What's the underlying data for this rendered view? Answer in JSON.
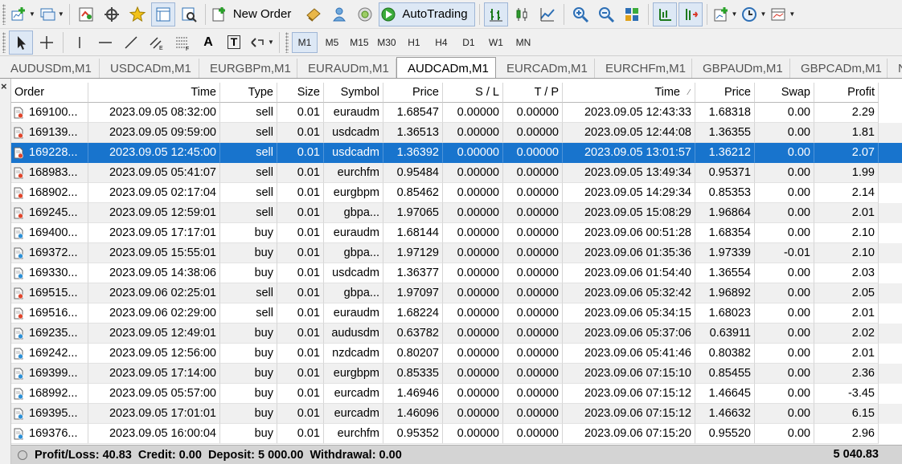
{
  "toolbar_main": {
    "new_order_label": "New Order",
    "autotrading_label": "AutoTrading"
  },
  "toolbar_draw": {
    "timeframes": [
      "M1",
      "M5",
      "M15",
      "M30",
      "H1",
      "H4",
      "D1",
      "W1",
      "MN"
    ],
    "active_timeframe": "M1",
    "text_tool_glyph": "A",
    "text_label_glyph": "T"
  },
  "tabs": [
    "AUDUSDm,M1",
    "USDCADm,M1",
    "EURGBPm,M1",
    "EURAUDm,M1",
    "AUDCADm,M1",
    "EURCADm,M1",
    "EURCHFm,M1",
    "GBPAUDm,M1",
    "GBPCADm,M1",
    "N"
  ],
  "active_tab": "AUDCADm,M1",
  "close_glyph": "×",
  "columns": [
    "Order",
    "Time",
    "Type",
    "Size",
    "Symbol",
    "Price",
    "S / L",
    "T / P",
    "Time",
    "Price",
    "Swap",
    "Profit"
  ],
  "sort_indicator": "⁄",
  "rows": [
    {
      "order": "169100...",
      "open_time": "2023.09.05 08:32:00",
      "type": "sell",
      "size": "0.01",
      "symbol": "euraudm",
      "price": "1.68547",
      "sl": "0.00000",
      "tp": "0.00000",
      "close_time": "2023.09.05 12:43:33",
      "close_price": "1.68318",
      "swap": "0.00",
      "profit": "2.29"
    },
    {
      "order": "169139...",
      "open_time": "2023.09.05 09:59:00",
      "type": "sell",
      "size": "0.01",
      "symbol": "usdcadm",
      "price": "1.36513",
      "sl": "0.00000",
      "tp": "0.00000",
      "close_time": "2023.09.05 12:44:08",
      "close_price": "1.36355",
      "swap": "0.00",
      "profit": "1.81"
    },
    {
      "order": "169228...",
      "open_time": "2023.09.05 12:45:00",
      "type": "sell",
      "size": "0.01",
      "symbol": "usdcadm",
      "price": "1.36392",
      "sl": "0.00000",
      "tp": "0.00000",
      "close_time": "2023.09.05 13:01:57",
      "close_price": "1.36212",
      "swap": "0.00",
      "profit": "2.07"
    },
    {
      "order": "168983...",
      "open_time": "2023.09.05 05:41:07",
      "type": "sell",
      "size": "0.01",
      "symbol": "eurchfm",
      "price": "0.95484",
      "sl": "0.00000",
      "tp": "0.00000",
      "close_time": "2023.09.05 13:49:34",
      "close_price": "0.95371",
      "swap": "0.00",
      "profit": "1.99"
    },
    {
      "order": "168902...",
      "open_time": "2023.09.05 02:17:04",
      "type": "sell",
      "size": "0.01",
      "symbol": "eurgbpm",
      "price": "0.85462",
      "sl": "0.00000",
      "tp": "0.00000",
      "close_time": "2023.09.05 14:29:34",
      "close_price": "0.85353",
      "swap": "0.00",
      "profit": "2.14"
    },
    {
      "order": "169245...",
      "open_time": "2023.09.05 12:59:01",
      "type": "sell",
      "size": "0.01",
      "symbol": "gbpa...",
      "price": "1.97065",
      "sl": "0.00000",
      "tp": "0.00000",
      "close_time": "2023.09.05 15:08:29",
      "close_price": "1.96864",
      "swap": "0.00",
      "profit": "2.01"
    },
    {
      "order": "169400...",
      "open_time": "2023.09.05 17:17:01",
      "type": "buy",
      "size": "0.01",
      "symbol": "euraudm",
      "price": "1.68144",
      "sl": "0.00000",
      "tp": "0.00000",
      "close_time": "2023.09.06 00:51:28",
      "close_price": "1.68354",
      "swap": "0.00",
      "profit": "2.10"
    },
    {
      "order": "169372...",
      "open_time": "2023.09.05 15:55:01",
      "type": "buy",
      "size": "0.01",
      "symbol": "gbpa...",
      "price": "1.97129",
      "sl": "0.00000",
      "tp": "0.00000",
      "close_time": "2023.09.06 01:35:36",
      "close_price": "1.97339",
      "swap": "-0.01",
      "profit": "2.10"
    },
    {
      "order": "169330...",
      "open_time": "2023.09.05 14:38:06",
      "type": "buy",
      "size": "0.01",
      "symbol": "usdcadm",
      "price": "1.36377",
      "sl": "0.00000",
      "tp": "0.00000",
      "close_time": "2023.09.06 01:54:40",
      "close_price": "1.36554",
      "swap": "0.00",
      "profit": "2.03"
    },
    {
      "order": "169515...",
      "open_time": "2023.09.06 02:25:01",
      "type": "sell",
      "size": "0.01",
      "symbol": "gbpa...",
      "price": "1.97097",
      "sl": "0.00000",
      "tp": "0.00000",
      "close_time": "2023.09.06 05:32:42",
      "close_price": "1.96892",
      "swap": "0.00",
      "profit": "2.05"
    },
    {
      "order": "169516...",
      "open_time": "2023.09.06 02:29:00",
      "type": "sell",
      "size": "0.01",
      "symbol": "euraudm",
      "price": "1.68224",
      "sl": "0.00000",
      "tp": "0.00000",
      "close_time": "2023.09.06 05:34:15",
      "close_price": "1.68023",
      "swap": "0.00",
      "profit": "2.01"
    },
    {
      "order": "169235...",
      "open_time": "2023.09.05 12:49:01",
      "type": "buy",
      "size": "0.01",
      "symbol": "audusdm",
      "price": "0.63782",
      "sl": "0.00000",
      "tp": "0.00000",
      "close_time": "2023.09.06 05:37:06",
      "close_price": "0.63911",
      "swap": "0.00",
      "profit": "2.02"
    },
    {
      "order": "169242...",
      "open_time": "2023.09.05 12:56:00",
      "type": "buy",
      "size": "0.01",
      "symbol": "nzdcadm",
      "price": "0.80207",
      "sl": "0.00000",
      "tp": "0.00000",
      "close_time": "2023.09.06 05:41:46",
      "close_price": "0.80382",
      "swap": "0.00",
      "profit": "2.01"
    },
    {
      "order": "169399...",
      "open_time": "2023.09.05 17:14:00",
      "type": "buy",
      "size": "0.01",
      "symbol": "eurgbpm",
      "price": "0.85335",
      "sl": "0.00000",
      "tp": "0.00000",
      "close_time": "2023.09.06 07:15:10",
      "close_price": "0.85455",
      "swap": "0.00",
      "profit": "2.36"
    },
    {
      "order": "168992...",
      "open_time": "2023.09.05 05:57:00",
      "type": "buy",
      "size": "0.01",
      "symbol": "eurcadm",
      "price": "1.46946",
      "sl": "0.00000",
      "tp": "0.00000",
      "close_time": "2023.09.06 07:15:12",
      "close_price": "1.46645",
      "swap": "0.00",
      "profit": "-3.45"
    },
    {
      "order": "169395...",
      "open_time": "2023.09.05 17:01:01",
      "type": "buy",
      "size": "0.01",
      "symbol": "eurcadm",
      "price": "1.46096",
      "sl": "0.00000",
      "tp": "0.00000",
      "close_time": "2023.09.06 07:15:12",
      "close_price": "1.46632",
      "swap": "0.00",
      "profit": "6.15"
    },
    {
      "order": "169376...",
      "open_time": "2023.09.05 16:00:04",
      "type": "buy",
      "size": "0.01",
      "symbol": "eurchfm",
      "price": "0.95352",
      "sl": "0.00000",
      "tp": "0.00000",
      "close_time": "2023.09.06 07:15:20",
      "close_price": "0.95520",
      "swap": "0.00",
      "profit": "2.96"
    }
  ],
  "selected_row_index": 2,
  "footer": {
    "summary": "Profit/Loss: 40.83  Credit: 0.00  Deposit: 5 000.00  Withdrawal: 0.00",
    "balance": "5 040.83"
  },
  "colors": {
    "selection": "#1874cd",
    "sell_dot": "#e0452b",
    "buy_dot": "#2b8fd6",
    "alt_row": "#f0f0f0"
  },
  "icons": {
    "toolbar_main": [
      "new-chart-icon",
      "profiles-icon",
      "market-watch-icon",
      "navigator-icon",
      "favorites-icon",
      "terminal-icon",
      "strategy-tester-icon",
      "new-order-icon",
      "market-icon",
      "signals-icon",
      "radio-icon",
      "autotrading-icon",
      "bar-chart-icon",
      "candlestick-icon",
      "line-chart-icon",
      "zoom-in-icon",
      "zoom-out-icon",
      "tile-windows-icon",
      "chart-shift-icon",
      "autoscroll-icon",
      "indicators-icon",
      "periodicity-icon",
      "templates-icon"
    ],
    "toolbar_draw": [
      "cursor-icon",
      "crosshair-icon",
      "vertical-line-icon",
      "horizontal-line-icon",
      "trendline-icon",
      "equidistant-channel-icon",
      "fibonacci-icon",
      "text-icon",
      "text-label-icon",
      "arrows-icon"
    ],
    "row_ticket": "ticket-icon"
  }
}
